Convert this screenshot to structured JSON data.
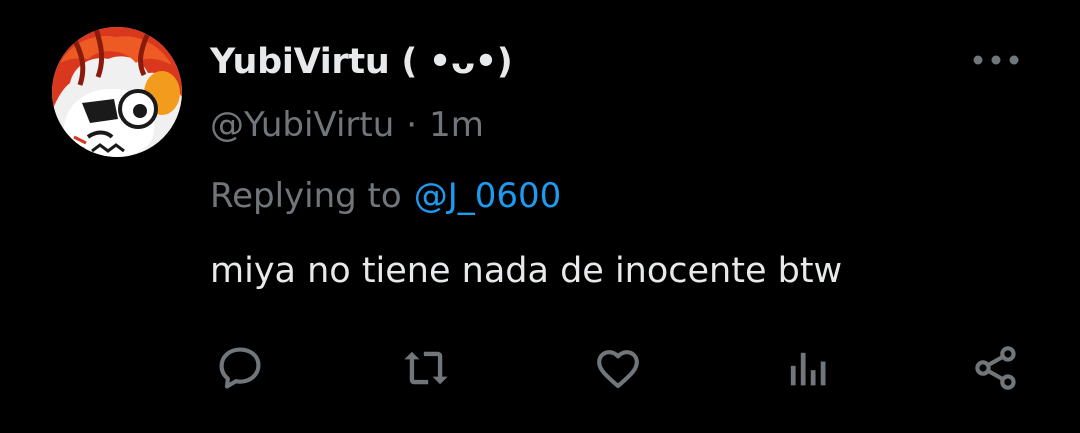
{
  "tweet": {
    "display_name": "YubiVirtu ( •ᴗ•)",
    "handle": "@YubiVirtu",
    "separator": "·",
    "time": "1m",
    "replying_prefix": "Replying to",
    "replying_to": "@J_0600",
    "text": "miya no tiene nada de inocente btw"
  },
  "actions": [
    {
      "name": "reply",
      "icon": "speech-bubble-icon"
    },
    {
      "name": "retweet",
      "icon": "retweet-icon"
    },
    {
      "name": "like",
      "icon": "heart-icon"
    },
    {
      "name": "views",
      "icon": "bar-chart-icon"
    },
    {
      "name": "share",
      "icon": "share-icon"
    }
  ],
  "colors": {
    "background": "#000000",
    "primary_text": "#e7e9ea",
    "secondary_text": "#71767b",
    "link": "#1d9bf0"
  }
}
